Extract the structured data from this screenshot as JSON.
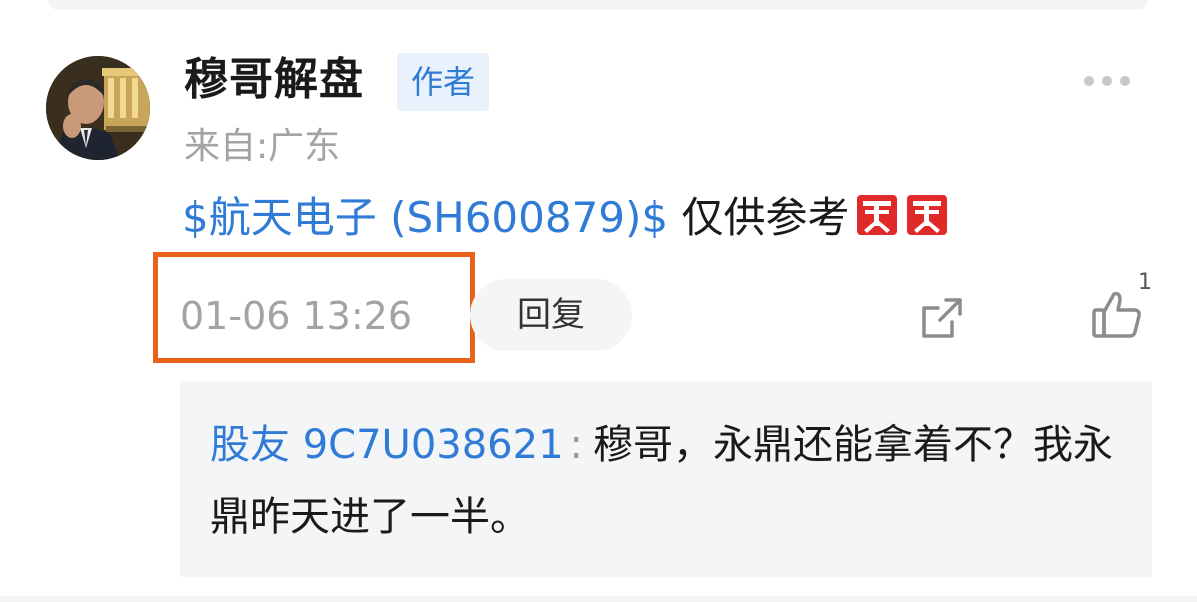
{
  "post": {
    "username": "穆哥解盘",
    "author_badge": "作者",
    "location": "来自:广东",
    "stock_link": "$航天电子 (SH600879)$",
    "text": " 仅供参考",
    "emojis": [
      "buy-emoji",
      "buy-emoji"
    ],
    "timestamp": "01-06 13:26",
    "reply_label": "回复",
    "like_count": "1"
  },
  "reply": {
    "user": "股友 9C7U038621",
    "separator": ":",
    "text": "穆哥，永鼎还能拿着不？我永鼎昨天进了一半。"
  },
  "colors": {
    "link_blue": "#2f7bd6",
    "highlight_orange": "#e8621c",
    "badge_bg": "#e8f1fc",
    "muted_gray": "#a3a3a3",
    "emoji_red": "#e02a2a"
  }
}
